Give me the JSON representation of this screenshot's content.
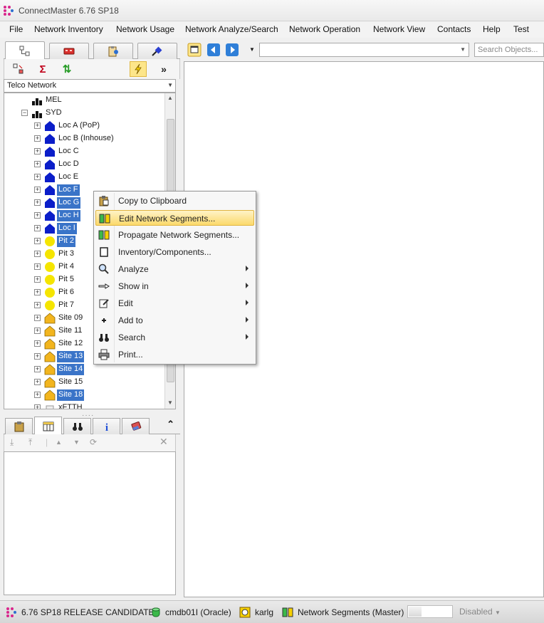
{
  "window": {
    "title": "ConnectMaster 6.76 SP18"
  },
  "menu": [
    "File",
    "Network Inventory",
    "Network Usage",
    "Network Analyze/Search",
    "Network Operation",
    "Network View",
    "Contacts",
    "Help",
    "Test"
  ],
  "left_panel": {
    "tabs": [
      {
        "icon": "network-tree-icon"
      },
      {
        "icon": "equipment-icon"
      },
      {
        "icon": "clipboard-user-icon"
      },
      {
        "icon": "cable-connector-icon"
      }
    ],
    "toolbar": [
      {
        "icon": "node-select-icon"
      },
      {
        "icon": "sigma-icon"
      },
      {
        "icon": "refresh-icon"
      },
      {
        "icon": "lightning-icon"
      },
      {
        "icon": "more-icon"
      }
    ],
    "network_select": "Telco Network",
    "tree": [
      {
        "label": "MEL",
        "icon": "city-icon",
        "level": 1,
        "selected": false
      },
      {
        "label": "SYD",
        "icon": "city-icon",
        "level": 1,
        "selected": false
      },
      {
        "label": "Loc A (PoP)",
        "icon": "location-icon",
        "level": 2,
        "selected": false
      },
      {
        "label": "Loc B (Inhouse)",
        "icon": "location-icon",
        "level": 2,
        "selected": false
      },
      {
        "label": "Loc C",
        "icon": "location-icon",
        "level": 2,
        "selected": false
      },
      {
        "label": "Loc D",
        "icon": "location-icon",
        "level": 2,
        "selected": false
      },
      {
        "label": "Loc E",
        "icon": "location-icon",
        "level": 2,
        "selected": false
      },
      {
        "label": "Loc F",
        "icon": "location-icon",
        "level": 2,
        "selected": true
      },
      {
        "label": "Loc G",
        "icon": "location-icon",
        "level": 2,
        "selected": true
      },
      {
        "label": "Loc H",
        "icon": "location-icon",
        "level": 2,
        "selected": true
      },
      {
        "label": "Loc I",
        "icon": "location-icon",
        "level": 2,
        "selected": true
      },
      {
        "label": "Pit 2",
        "icon": "pit-icon",
        "level": 2,
        "selected": true
      },
      {
        "label": "Pit 3",
        "icon": "pit-icon",
        "level": 2,
        "selected": false
      },
      {
        "label": "Pit 4",
        "icon": "pit-icon",
        "level": 2,
        "selected": false
      },
      {
        "label": "Pit 5",
        "icon": "pit-icon",
        "level": 2,
        "selected": false
      },
      {
        "label": "Pit 6",
        "icon": "pit-icon",
        "level": 2,
        "selected": false
      },
      {
        "label": "Pit 7",
        "icon": "pit-icon",
        "level": 2,
        "selected": false
      },
      {
        "label": "Site 09",
        "icon": "site-icon",
        "level": 2,
        "selected": false
      },
      {
        "label": "Site 11",
        "icon": "site-icon",
        "level": 2,
        "selected": false
      },
      {
        "label": "Site 12",
        "icon": "site-icon",
        "level": 2,
        "selected": false
      },
      {
        "label": "Site 13",
        "icon": "site-icon",
        "level": 2,
        "selected": true
      },
      {
        "label": "Site 14",
        "icon": "site-icon",
        "level": 2,
        "selected": true
      },
      {
        "label": "Site 15",
        "icon": "site-icon",
        "level": 2,
        "selected": false
      },
      {
        "label": "Site 18",
        "icon": "site-icon",
        "level": 2,
        "selected": true
      },
      {
        "label": "xFTTH",
        "icon": "folder-icon",
        "level": 2,
        "selected": false
      }
    ],
    "bottom_tabs": [
      {
        "icon": "clipboard-icon"
      },
      {
        "icon": "table-icon"
      },
      {
        "icon": "binoculars-icon"
      },
      {
        "icon": "info-icon"
      },
      {
        "icon": "eraser-icon"
      }
    ],
    "collapse_glyph": "⌃"
  },
  "right_panel": {
    "search_placeholder": "Search Objects..."
  },
  "context_menu": [
    {
      "label": "Copy to Clipboard",
      "icon": "clipboard-copy-icon",
      "submenu": false,
      "highlighted": false
    },
    {
      "label": "Edit Network Segments...",
      "icon": "network-segments-icon",
      "submenu": false,
      "highlighted": true
    },
    {
      "label": "Propagate Network Segments...",
      "icon": "network-segments-icon",
      "submenu": false,
      "highlighted": false
    },
    {
      "label": "Inventory/Components...",
      "icon": "component-icon",
      "submenu": false,
      "highlighted": false
    },
    {
      "label": "Analyze",
      "icon": "magnifier-icon",
      "submenu": true,
      "highlighted": false
    },
    {
      "label": "Show in",
      "icon": "pointing-hand-icon",
      "submenu": true,
      "highlighted": false
    },
    {
      "label": "Edit",
      "icon": "edit-icon",
      "submenu": true,
      "highlighted": false
    },
    {
      "label": "Add to",
      "icon": "plus-icon",
      "submenu": true,
      "highlighted": false
    },
    {
      "label": "Search",
      "icon": "binoculars-icon",
      "submenu": true,
      "highlighted": false
    },
    {
      "label": "Print...",
      "icon": "printer-icon",
      "submenu": false,
      "highlighted": false
    }
  ],
  "status": {
    "version": "6.76 SP18 RELEASE CANDIDATE",
    "database": "cmdb01I (Oracle)",
    "user": "karlg",
    "segments": "Network Segments (Master)",
    "mode": "Disabled",
    "progress": 0.3
  },
  "colors": {
    "selection": "#3a74c8",
    "location": "#0b1ec9",
    "pit": "#f5e500",
    "site": "#f2b51e",
    "highlight": "#fbd96b"
  }
}
